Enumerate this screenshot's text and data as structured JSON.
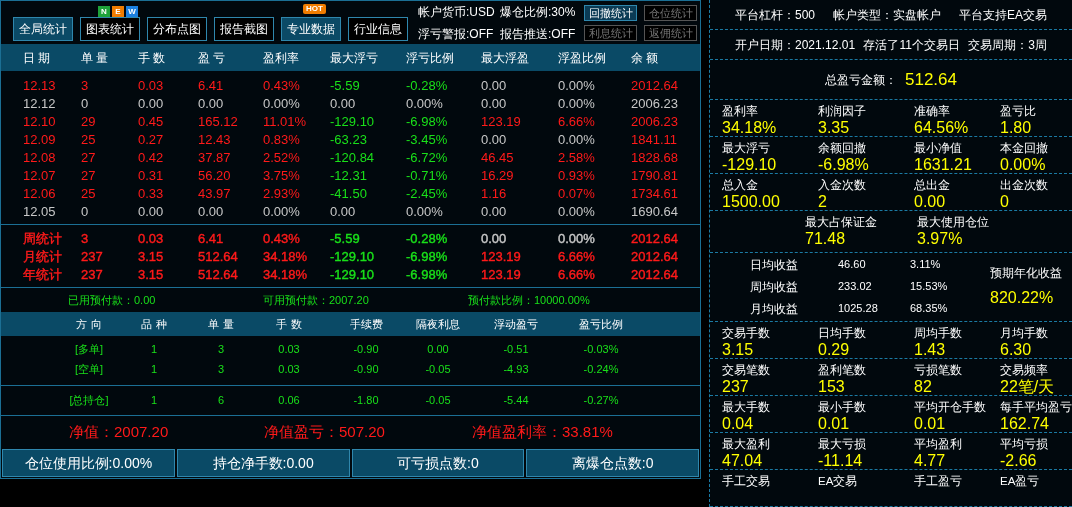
{
  "toolbar": {
    "buttons": [
      {
        "label": "全局统计",
        "selected": true
      },
      {
        "label": "图表统计",
        "selected": false,
        "badge": {
          "kind": "letters",
          "letters": [
            {
              "text": "N",
              "color": "#1fa33a"
            },
            {
              "text": "E",
              "color": "#f07c00"
            },
            {
              "text": "W",
              "color": "#1a7fe0"
            }
          ]
        }
      },
      {
        "label": "分布点图",
        "selected": false
      },
      {
        "label": "报告截图",
        "selected": false
      },
      {
        "label": "专业数据",
        "selected": true,
        "badge": {
          "kind": "tag",
          "text": "HOT"
        }
      },
      {
        "label": "行业信息",
        "selected": false
      }
    ],
    "account_info": [
      "帐户货币:USD",
      "爆仓比例:30%",
      "浮亏警报:OFF",
      "报告推送:OFF"
    ],
    "side_buttons": [
      {
        "label": "回撤统计",
        "selected": true
      },
      {
        "label": "仓位统计",
        "selected": false
      },
      {
        "label": "利息统计",
        "selected": false
      },
      {
        "label": "返佣统计",
        "selected": false
      }
    ]
  },
  "table": {
    "columns": [
      "日 期",
      "单 量",
      "手 数",
      "盈 亏",
      "盈利率",
      "最大浮亏",
      "浮亏比例",
      "最大浮盈",
      "浮盈比例",
      "余 额"
    ],
    "rows": [
      [
        {
          "text": "12.13",
          "color": "#ff1a1a"
        },
        {
          "text": "3",
          "color": "#ff1a1a"
        },
        {
          "text": "0.03",
          "color": "#ff1a1a"
        },
        {
          "text": "6.41",
          "color": "#ff1a1a"
        },
        {
          "text": "0.43%",
          "color": "#ff1a1a"
        },
        {
          "text": "-5.59",
          "color": "#19e019"
        },
        {
          "text": "-0.28%",
          "color": "#19e019"
        },
        {
          "text": "0.00",
          "color": "#c8c8c8"
        },
        {
          "text": "0.00%",
          "color": "#c8c8c8"
        },
        {
          "text": "2012.64",
          "color": "#ff1a1a"
        }
      ],
      [
        {
          "text": "12.12",
          "color": "#c8c8c8"
        },
        {
          "text": "0",
          "color": "#c8c8c8"
        },
        {
          "text": "0.00",
          "color": "#c8c8c8"
        },
        {
          "text": "0.00",
          "color": "#c8c8c8"
        },
        {
          "text": "0.00%",
          "color": "#c8c8c8"
        },
        {
          "text": "0.00",
          "color": "#c8c8c8"
        },
        {
          "text": "0.00%",
          "color": "#c8c8c8"
        },
        {
          "text": "0.00",
          "color": "#c8c8c8"
        },
        {
          "text": "0.00%",
          "color": "#c8c8c8"
        },
        {
          "text": "2006.23",
          "color": "#c8c8c8"
        }
      ],
      [
        {
          "text": "12.10",
          "color": "#ff1a1a"
        },
        {
          "text": "29",
          "color": "#ff1a1a"
        },
        {
          "text": "0.45",
          "color": "#ff1a1a"
        },
        {
          "text": "165.12",
          "color": "#ff1a1a"
        },
        {
          "text": "11.01%",
          "color": "#ff1a1a"
        },
        {
          "text": "-129.10",
          "color": "#19e019"
        },
        {
          "text": "-6.98%",
          "color": "#19e019"
        },
        {
          "text": "123.19",
          "color": "#ff1a1a"
        },
        {
          "text": "6.66%",
          "color": "#ff1a1a"
        },
        {
          "text": "2006.23",
          "color": "#ff1a1a"
        }
      ],
      [
        {
          "text": "12.09",
          "color": "#ff1a1a"
        },
        {
          "text": "25",
          "color": "#ff1a1a"
        },
        {
          "text": "0.27",
          "color": "#ff1a1a"
        },
        {
          "text": "12.43",
          "color": "#ff1a1a"
        },
        {
          "text": "0.83%",
          "color": "#ff1a1a"
        },
        {
          "text": "-63.23",
          "color": "#19e019"
        },
        {
          "text": "-3.45%",
          "color": "#19e019"
        },
        {
          "text": "0.00",
          "color": "#c8c8c8"
        },
        {
          "text": "0.00%",
          "color": "#c8c8c8"
        },
        {
          "text": "1841.11",
          "color": "#ff1a1a"
        }
      ],
      [
        {
          "text": "12.08",
          "color": "#ff1a1a"
        },
        {
          "text": "27",
          "color": "#ff1a1a"
        },
        {
          "text": "0.42",
          "color": "#ff1a1a"
        },
        {
          "text": "37.87",
          "color": "#ff1a1a"
        },
        {
          "text": "2.52%",
          "color": "#ff1a1a"
        },
        {
          "text": "-120.84",
          "color": "#19e019"
        },
        {
          "text": "-6.72%",
          "color": "#19e019"
        },
        {
          "text": "46.45",
          "color": "#ff1a1a"
        },
        {
          "text": "2.58%",
          "color": "#ff1a1a"
        },
        {
          "text": "1828.68",
          "color": "#ff1a1a"
        }
      ],
      [
        {
          "text": "12.07",
          "color": "#ff1a1a"
        },
        {
          "text": "27",
          "color": "#ff1a1a"
        },
        {
          "text": "0.31",
          "color": "#ff1a1a"
        },
        {
          "text": "56.20",
          "color": "#ff1a1a"
        },
        {
          "text": "3.75%",
          "color": "#ff1a1a"
        },
        {
          "text": "-12.31",
          "color": "#19e019"
        },
        {
          "text": "-0.71%",
          "color": "#19e019"
        },
        {
          "text": "16.29",
          "color": "#ff1a1a"
        },
        {
          "text": "0.93%",
          "color": "#ff1a1a"
        },
        {
          "text": "1790.81",
          "color": "#ff1a1a"
        }
      ],
      [
        {
          "text": "12.06",
          "color": "#ff1a1a"
        },
        {
          "text": "25",
          "color": "#ff1a1a"
        },
        {
          "text": "0.33",
          "color": "#ff1a1a"
        },
        {
          "text": "43.97",
          "color": "#ff1a1a"
        },
        {
          "text": "2.93%",
          "color": "#ff1a1a"
        },
        {
          "text": "-41.50",
          "color": "#19e019"
        },
        {
          "text": "-2.45%",
          "color": "#19e019"
        },
        {
          "text": "1.16",
          "color": "#ff1a1a"
        },
        {
          "text": "0.07%",
          "color": "#ff1a1a"
        },
        {
          "text": "1734.61",
          "color": "#ff1a1a"
        }
      ],
      [
        {
          "text": "12.05",
          "color": "#c8c8c8"
        },
        {
          "text": "0",
          "color": "#c8c8c8"
        },
        {
          "text": "0.00",
          "color": "#c8c8c8"
        },
        {
          "text": "0.00",
          "color": "#c8c8c8"
        },
        {
          "text": "0.00%",
          "color": "#c8c8c8"
        },
        {
          "text": "0.00",
          "color": "#c8c8c8"
        },
        {
          "text": "0.00%",
          "color": "#c8c8c8"
        },
        {
          "text": "0.00",
          "color": "#c8c8c8"
        },
        {
          "text": "0.00%",
          "color": "#c8c8c8"
        },
        {
          "text": "1690.64",
          "color": "#c8c8c8"
        }
      ]
    ],
    "summary_rows": [
      [
        {
          "text": "周统计",
          "color": "#ff1a1a"
        },
        {
          "text": "3",
          "color": "#ff1a1a"
        },
        {
          "text": "0.03",
          "color": "#ff1a1a"
        },
        {
          "text": "6.41",
          "color": "#ff1a1a"
        },
        {
          "text": "0.43%",
          "color": "#ff1a1a"
        },
        {
          "text": "-5.59",
          "color": "#19e019"
        },
        {
          "text": "-0.28%",
          "color": "#19e019"
        },
        {
          "text": "0.00",
          "color": "#c8c8c8"
        },
        {
          "text": "0.00%",
          "color": "#c8c8c8"
        },
        {
          "text": "2012.64",
          "color": "#ff1a1a"
        }
      ],
      [
        {
          "text": "月统计",
          "color": "#ff1a1a"
        },
        {
          "text": "237",
          "color": "#ff1a1a"
        },
        {
          "text": "3.15",
          "color": "#ff1a1a"
        },
        {
          "text": "512.64",
          "color": "#ff1a1a"
        },
        {
          "text": "34.18%",
          "color": "#ff1a1a"
        },
        {
          "text": "-129.10",
          "color": "#19e019"
        },
        {
          "text": "-6.98%",
          "color": "#19e019"
        },
        {
          "text": "123.19",
          "color": "#ff1a1a"
        },
        {
          "text": "6.66%",
          "color": "#ff1a1a"
        },
        {
          "text": "2012.64",
          "color": "#ff1a1a"
        }
      ],
      [
        {
          "text": "年统计",
          "color": "#ff1a1a"
        },
        {
          "text": "237",
          "color": "#ff1a1a"
        },
        {
          "text": "3.15",
          "color": "#ff1a1a"
        },
        {
          "text": "512.64",
          "color": "#ff1a1a"
        },
        {
          "text": "34.18%",
          "color": "#ff1a1a"
        },
        {
          "text": "-129.10",
          "color": "#19e019"
        },
        {
          "text": "-6.98%",
          "color": "#19e019"
        },
        {
          "text": "123.19",
          "color": "#ff1a1a"
        },
        {
          "text": "6.66%",
          "color": "#ff1a1a"
        },
        {
          "text": "2012.64",
          "color": "#ff1a1a"
        }
      ]
    ]
  },
  "prepayment": [
    "已用预付款：0.00",
    "可用预付款：2007.20",
    "预付款比例：10000.00%"
  ],
  "positions": {
    "columns": [
      "方 向",
      "品 种",
      "单 量",
      "手 数",
      "手续费",
      "隔夜利息",
      "浮动盈亏",
      "盈亏比例"
    ],
    "rows": [
      [
        "[多单]",
        "1",
        "3",
        "0.03",
        "-0.90",
        "0.00",
        "-0.51",
        "-0.03%"
      ],
      [
        "[空单]",
        "1",
        "3",
        "0.03",
        "-0.90",
        "-0.05",
        "-4.93",
        "-0.24%"
      ]
    ],
    "total": [
      "[总持仓]",
      "1",
      "6",
      "0.06",
      "-1.80",
      "-0.05",
      "-5.44",
      "-0.27%"
    ]
  },
  "net_values": [
    "净值：2007.20",
    "净值盈亏：507.20",
    "净值盈利率：33.81%"
  ],
  "status_bar": [
    "仓位使用比例:0.00%",
    "持仓净手数:0.00",
    "可亏损点数:0",
    "离爆仓点数:0"
  ],
  "stats_panel": [
    {
      "kind": "inline",
      "items": [
        "平台杠杆：500",
        "帐户类型：实盘帐户",
        "平台支持EA交易"
      ]
    },
    {
      "kind": "inline",
      "items": [
        "开户日期：2021.12.01",
        "存活了11个交易日",
        "交易周期：3周"
      ]
    },
    {
      "kind": "total",
      "label": "总盈亏金额：",
      "value": "512.64"
    },
    {
      "kind": "grid",
      "items": [
        {
          "label": "盈利率",
          "value": "34.18%"
        },
        {
          "label": "利润因子",
          "value": "3.35"
        },
        {
          "label": "准确率",
          "value": "64.56%"
        },
        {
          "label": "盈亏比",
          "value": "1.80"
        }
      ]
    },
    {
      "kind": "grid",
      "items": [
        {
          "label": "最大浮亏",
          "value": "-129.10"
        },
        {
          "label": "余额回撤",
          "value": "-6.98%"
        },
        {
          "label": "最小净值",
          "value": "1631.21"
        },
        {
          "label": "本金回撤",
          "value": "0.00%"
        }
      ]
    },
    {
      "kind": "grid",
      "items": [
        {
          "label": "总入金",
          "value": "1500.00"
        },
        {
          "label": "入金次数",
          "value": "2"
        },
        {
          "label": "总出金",
          "value": "0.00"
        },
        {
          "label": "出金次数",
          "value": "0"
        }
      ]
    },
    {
      "kind": "pair",
      "items": [
        {
          "label": "最大占保证金",
          "value": "71.48"
        },
        {
          "label": "最大使用仓位",
          "value": "3.97%"
        }
      ]
    },
    {
      "kind": "averages",
      "rows": [
        {
          "label": "日均收益",
          "amount": "46.60",
          "ratio": "3.11%"
        },
        {
          "label": "周均收益",
          "amount": "233.02",
          "ratio": "15.53%"
        },
        {
          "label": "月均收益",
          "amount": "1025.28",
          "ratio": "68.35%"
        }
      ],
      "forecast": {
        "label": "预期年化收益",
        "value": "820.22%"
      }
    },
    {
      "kind": "grid",
      "items": [
        {
          "label": "交易手数",
          "value": "3.15"
        },
        {
          "label": "日均手数",
          "value": "0.29"
        },
        {
          "label": "周均手数",
          "value": "1.43"
        },
        {
          "label": "月均手数",
          "value": "6.30"
        }
      ]
    },
    {
      "kind": "grid",
      "items": [
        {
          "label": "交易笔数",
          "value": "237"
        },
        {
          "label": "盈利笔数",
          "value": "153"
        },
        {
          "label": "亏损笔数",
          "value": "82"
        },
        {
          "label": "交易频率",
          "value": "22笔/天"
        }
      ]
    },
    {
      "kind": "grid",
      "items": [
        {
          "label": "最大手数",
          "value": "0.04"
        },
        {
          "label": "最小手数",
          "value": "0.01"
        },
        {
          "label": "平均开仓手数",
          "value": "0.01"
        },
        {
          "label": "每手平均盈亏",
          "value": "162.74"
        }
      ]
    },
    {
      "kind": "grid",
      "items": [
        {
          "label": "最大盈利",
          "value": "47.04"
        },
        {
          "label": "最大亏损",
          "value": "-11.14"
        },
        {
          "label": "平均盈利",
          "value": "4.77"
        },
        {
          "label": "平均亏损",
          "value": "-2.66"
        }
      ]
    },
    {
      "kind": "grid",
      "items": [
        {
          "label": "手工交易"
        },
        {
          "label": "EA交易"
        },
        {
          "label": "手工盈亏"
        },
        {
          "label": "EA盈亏"
        }
      ]
    }
  ]
}
